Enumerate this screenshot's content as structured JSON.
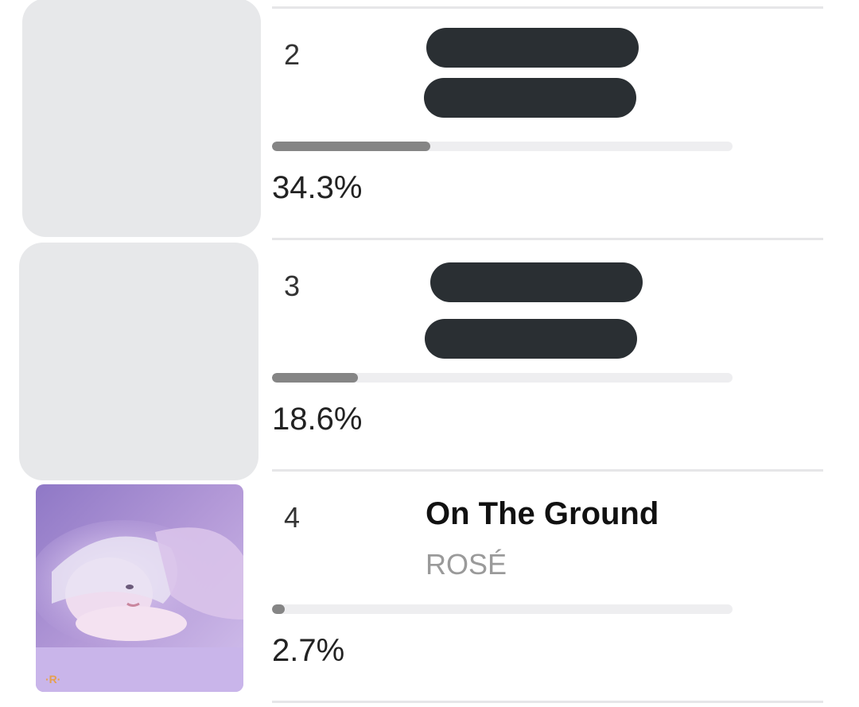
{
  "chart": [
    {
      "rank": "2",
      "title": "",
      "artist": "",
      "percent_text": "34.3%",
      "percent": 34.3
    },
    {
      "rank": "3",
      "title": "",
      "artist": "",
      "percent_text": "18.6%",
      "percent": 18.6
    },
    {
      "rank": "4",
      "title": "On The Ground",
      "artist": "ROSÉ",
      "percent_text": "2.7%",
      "percent": 2.7
    }
  ],
  "colors": {
    "bar_fill": "#858585",
    "bar_track": "#eeeef0",
    "redaction": "#2a2f33",
    "placeholder_thumb": "#e7e8ea",
    "artist_text": "#9a9a9a"
  },
  "icons": {
    "album_art": "album-art-image"
  }
}
